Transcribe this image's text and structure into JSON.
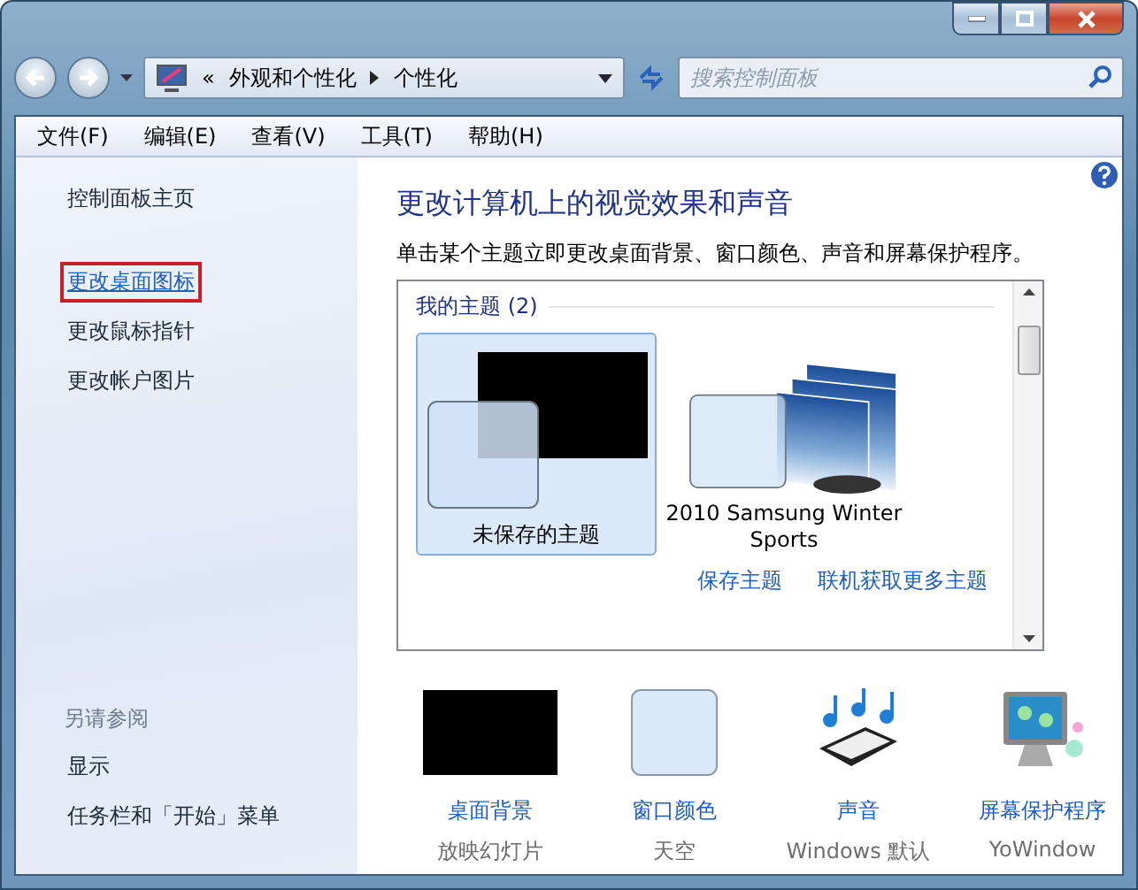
{
  "address_bar": {
    "overflow_mark": "«",
    "crumbs": [
      "外观和个性化",
      "个性化"
    ]
  },
  "search": {
    "placeholder": "搜索控制面板"
  },
  "menu": [
    "文件(F)",
    "编辑(E)",
    "查看(V)",
    "工具(T)",
    "帮助(H)"
  ],
  "sidebar": {
    "items": [
      {
        "label": "控制面板主页",
        "kind": "home",
        "selected": false
      },
      {
        "label": "更改桌面图标",
        "kind": "link",
        "selected": true
      },
      {
        "label": "更改鼠标指针",
        "kind": "link",
        "selected": false
      },
      {
        "label": "更改帐户图片",
        "kind": "link",
        "selected": false
      }
    ],
    "see_also": {
      "title": "另请参阅",
      "items": [
        "显示",
        "任务栏和「开始」菜单"
      ]
    }
  },
  "main": {
    "title": "更改计算机上的视觉效果和声音",
    "description": "单击某个主题立即更改桌面背景、窗口颜色、声音和屏幕保护程序。",
    "group": {
      "header": "我的主题 (2)",
      "themes": [
        {
          "name": "未保存的主题",
          "kind": "black",
          "selected": true
        },
        {
          "name": "2010 Samsung Winter Sports",
          "kind": "winter",
          "selected": false
        }
      ]
    },
    "links": [
      "保存主题",
      "联机获取更多主题"
    ]
  },
  "settings": [
    {
      "kind": "background",
      "label": "桌面背景",
      "value": "放映幻灯片"
    },
    {
      "kind": "color",
      "label": "窗口颜色",
      "value": "天空"
    },
    {
      "kind": "sound",
      "label": "声音",
      "value": "Windows 默认"
    },
    {
      "kind": "screensaver",
      "label": "屏幕保护程序",
      "value": "YoWindow"
    }
  ]
}
